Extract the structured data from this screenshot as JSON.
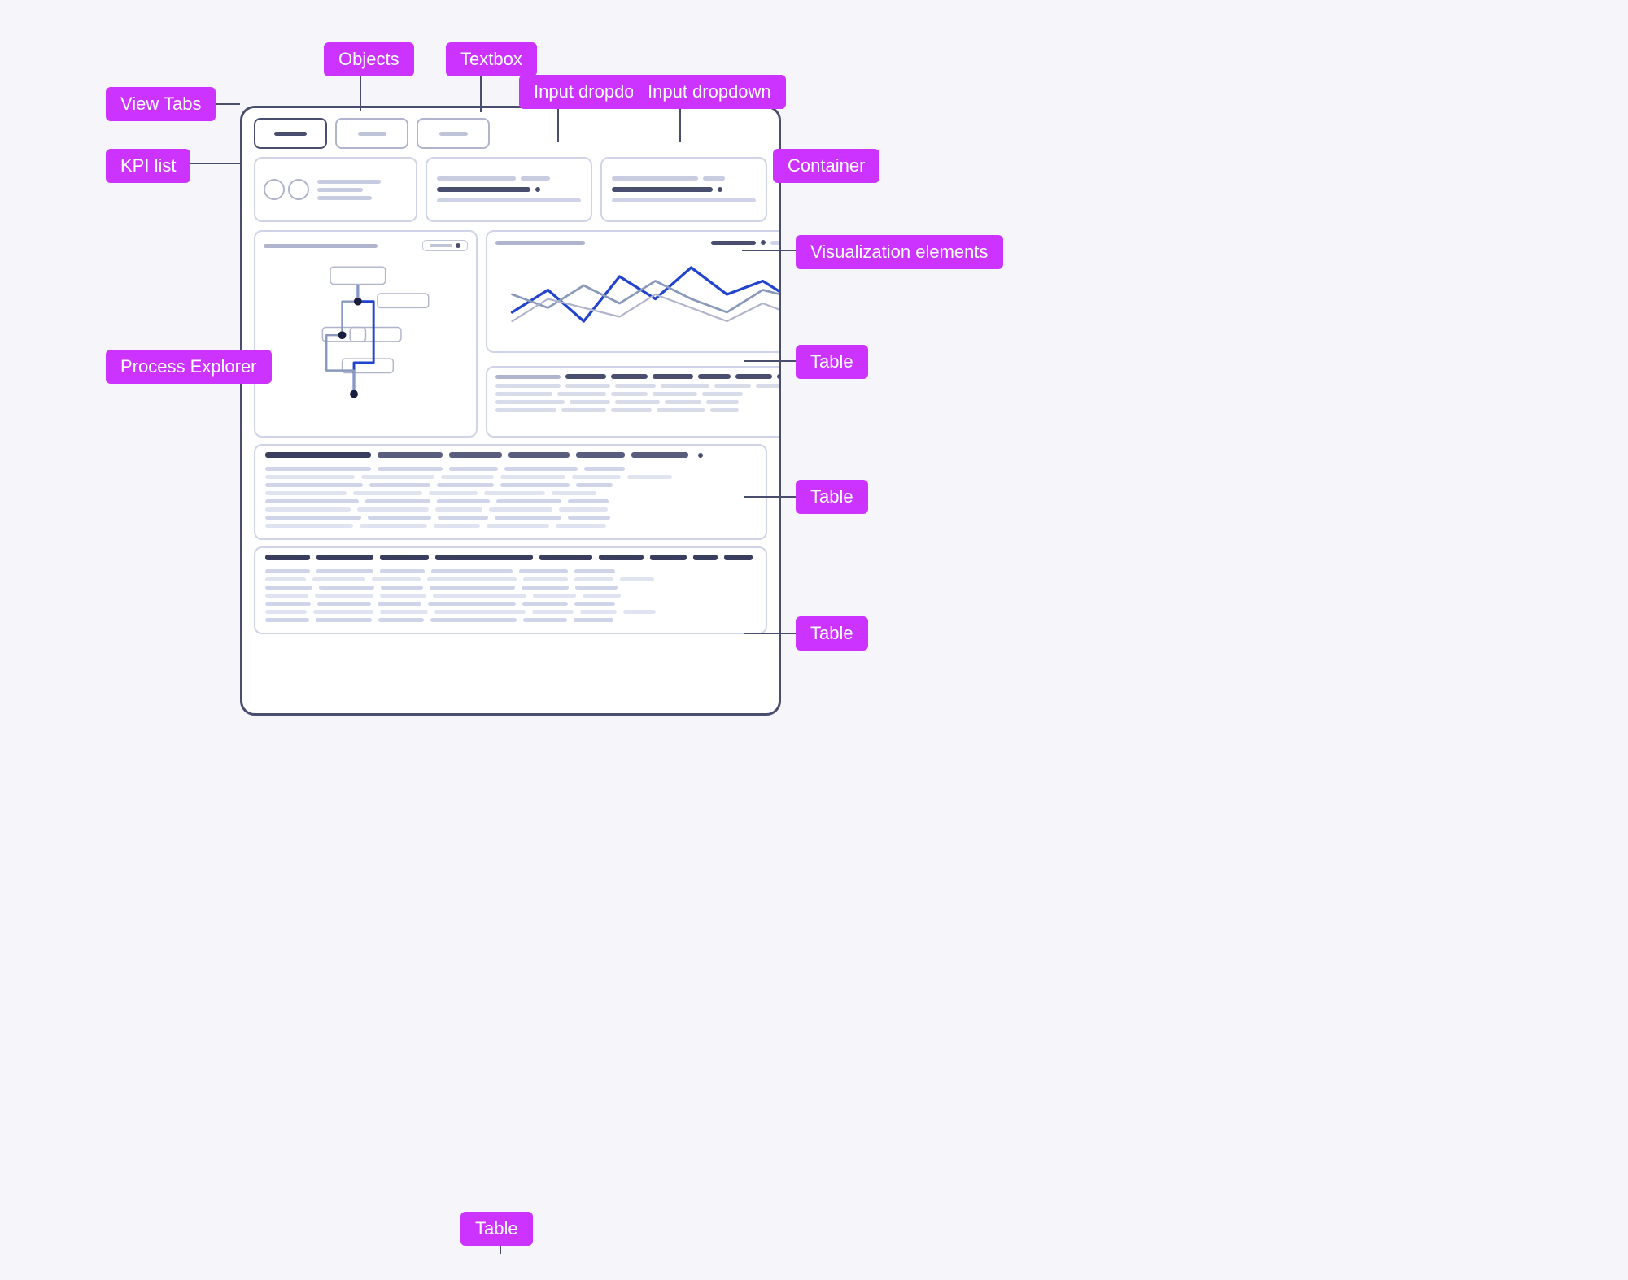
{
  "labels": {
    "view_tabs": "View Tabs",
    "objects": "Objects",
    "textbox": "Textbox",
    "input_dropdown_1": "Input dropdown",
    "input_dropdown_2": "Input dropdown",
    "kpi_list": "KPI list",
    "container": "Container",
    "visualization_elements": "Visualization elements",
    "process_explorer": "Process Explorer",
    "table_1": "Table",
    "table_2": "Table",
    "table_3": "Table",
    "table_bottom": "Table"
  },
  "colors": {
    "purple": "#cc33ff",
    "dark_navy": "#3a3e5e",
    "card_border": "#4a4e6e",
    "line_gray": "#c0c4d8",
    "accent_blue": "#2244cc",
    "accent_gray": "#8899bb"
  }
}
